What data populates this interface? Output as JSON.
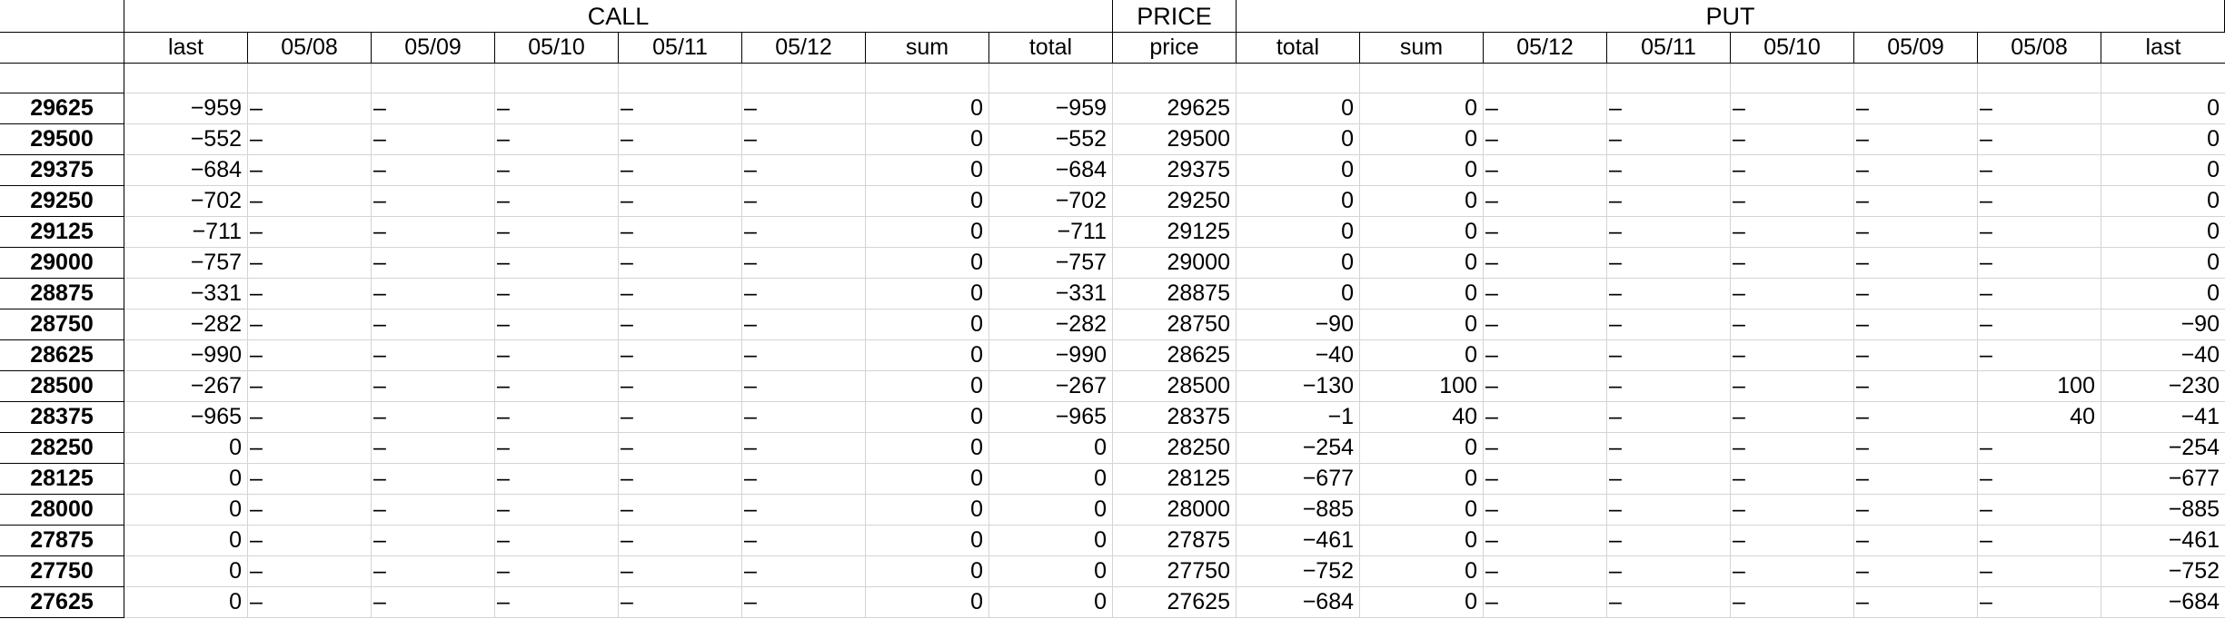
{
  "groups": {
    "call": "CALL",
    "price": "PRICE",
    "put": "PUT"
  },
  "headers": [
    "last",
    "05/08",
    "05/09",
    "05/10",
    "05/11",
    "05/12",
    "sum",
    "total",
    "price",
    "total",
    "sum",
    "05/12",
    "05/11",
    "05/10",
    "05/09",
    "05/08",
    "last"
  ],
  "rows": [
    {
      "label": "29625",
      "cells": [
        "−959",
        "–",
        "–",
        "–",
        "–",
        "–",
        "0",
        "−959",
        "29625",
        "0",
        "0",
        "–",
        "–",
        "–",
        "–",
        "–",
        "0"
      ]
    },
    {
      "label": "29500",
      "cells": [
        "−552",
        "–",
        "–",
        "–",
        "–",
        "–",
        "0",
        "−552",
        "29500",
        "0",
        "0",
        "–",
        "–",
        "–",
        "–",
        "–",
        "0"
      ]
    },
    {
      "label": "29375",
      "cells": [
        "−684",
        "–",
        "–",
        "–",
        "–",
        "–",
        "0",
        "−684",
        "29375",
        "0",
        "0",
        "–",
        "–",
        "–",
        "–",
        "–",
        "0"
      ]
    },
    {
      "label": "29250",
      "cells": [
        "−702",
        "–",
        "–",
        "–",
        "–",
        "–",
        "0",
        "−702",
        "29250",
        "0",
        "0",
        "–",
        "–",
        "–",
        "–",
        "–",
        "0"
      ]
    },
    {
      "label": "29125",
      "cells": [
        "−711",
        "–",
        "–",
        "–",
        "–",
        "–",
        "0",
        "−711",
        "29125",
        "0",
        "0",
        "–",
        "–",
        "–",
        "–",
        "–",
        "0"
      ]
    },
    {
      "label": "29000",
      "cells": [
        "−757",
        "–",
        "–",
        "–",
        "–",
        "–",
        "0",
        "−757",
        "29000",
        "0",
        "0",
        "–",
        "–",
        "–",
        "–",
        "–",
        "0"
      ]
    },
    {
      "label": "28875",
      "cells": [
        "−331",
        "–",
        "–",
        "–",
        "–",
        "–",
        "0",
        "−331",
        "28875",
        "0",
        "0",
        "–",
        "–",
        "–",
        "–",
        "–",
        "0"
      ]
    },
    {
      "label": "28750",
      "cells": [
        "−282",
        "–",
        "–",
        "–",
        "–",
        "–",
        "0",
        "−282",
        "28750",
        "−90",
        "0",
        "–",
        "–",
        "–",
        "–",
        "–",
        "−90"
      ]
    },
    {
      "label": "28625",
      "cells": [
        "−990",
        "–",
        "–",
        "–",
        "–",
        "–",
        "0",
        "−990",
        "28625",
        "−40",
        "0",
        "–",
        "–",
        "–",
        "–",
        "–",
        "−40"
      ]
    },
    {
      "label": "28500",
      "cells": [
        "−267",
        "–",
        "–",
        "–",
        "–",
        "–",
        "0",
        "−267",
        "28500",
        "−130",
        "100",
        "–",
        "–",
        "–",
        "–",
        "100",
        "−230"
      ]
    },
    {
      "label": "28375",
      "cells": [
        "−965",
        "–",
        "–",
        "–",
        "–",
        "–",
        "0",
        "−965",
        "28375",
        "−1",
        "40",
        "–",
        "–",
        "–",
        "–",
        "40",
        "−41"
      ]
    },
    {
      "label": "28250",
      "cells": [
        "0",
        "–",
        "–",
        "–",
        "–",
        "–",
        "0",
        "0",
        "28250",
        "−254",
        "0",
        "–",
        "–",
        "–",
        "–",
        "–",
        "−254"
      ]
    },
    {
      "label": "28125",
      "cells": [
        "0",
        "–",
        "–",
        "–",
        "–",
        "–",
        "0",
        "0",
        "28125",
        "−677",
        "0",
        "–",
        "–",
        "–",
        "–",
        "–",
        "−677"
      ]
    },
    {
      "label": "28000",
      "cells": [
        "0",
        "–",
        "–",
        "–",
        "–",
        "–",
        "0",
        "0",
        "28000",
        "−885",
        "0",
        "–",
        "–",
        "–",
        "–",
        "–",
        "−885"
      ]
    },
    {
      "label": "27875",
      "cells": [
        "0",
        "–",
        "–",
        "–",
        "–",
        "–",
        "0",
        "0",
        "27875",
        "−461",
        "0",
        "–",
        "–",
        "–",
        "–",
        "–",
        "−461"
      ]
    },
    {
      "label": "27750",
      "cells": [
        "0",
        "–",
        "–",
        "–",
        "–",
        "–",
        "0",
        "0",
        "27750",
        "−752",
        "0",
        "–",
        "–",
        "–",
        "–",
        "–",
        "−752"
      ]
    },
    {
      "label": "27625",
      "cells": [
        "0",
        "–",
        "–",
        "–",
        "–",
        "–",
        "0",
        "0",
        "27625",
        "−684",
        "0",
        "–",
        "–",
        "–",
        "–",
        "–",
        "−684"
      ]
    }
  ]
}
